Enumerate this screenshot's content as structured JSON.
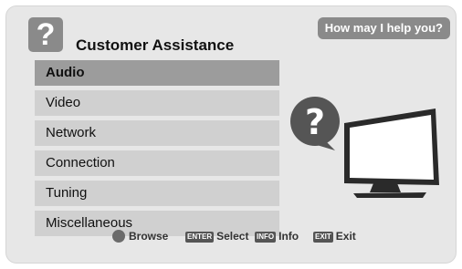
{
  "header": {
    "title": "Customer Assistance",
    "help_label": "How may I help you?",
    "help_icon": "?"
  },
  "menu": [
    {
      "label": "Audio",
      "selected": true
    },
    {
      "label": "Video",
      "selected": false
    },
    {
      "label": "Network",
      "selected": false
    },
    {
      "label": "Connection",
      "selected": false
    },
    {
      "label": "Tuning",
      "selected": false
    },
    {
      "label": "Miscellaneous",
      "selected": false
    }
  ],
  "footer": {
    "browse": "Browse",
    "enter_key": "ENTER",
    "select": "Select",
    "info_key": "INFO",
    "info": "Info",
    "exit_key": "EXIT",
    "exit": "Exit"
  },
  "illustration": {
    "icon": "question-bubble-and-tv",
    "bubble_text": "?"
  },
  "colors": {
    "panel_bg": "#e7e7e7",
    "menu_item_bg": "#d0d0d0",
    "menu_selected_bg": "#9c9c9c",
    "badge_bg": "#8a8a8a"
  }
}
